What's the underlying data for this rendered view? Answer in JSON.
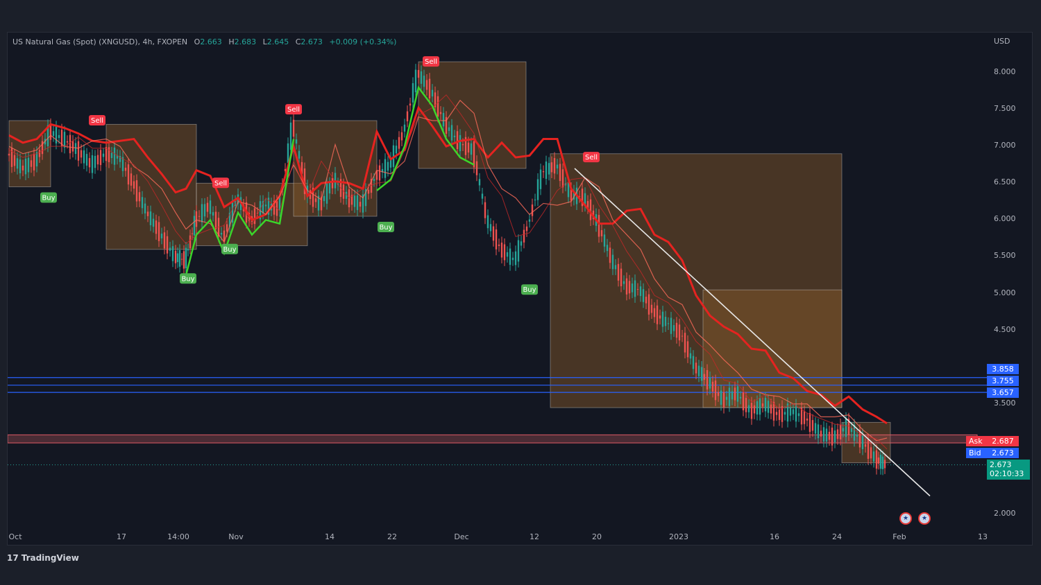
{
  "legend": {
    "symbol": "US Natural Gas (Spot) (XNGUSD), 4h, FXOPEN",
    "o_label": "O",
    "o_value": "2.663",
    "h_label": "H",
    "h_value": "2.683",
    "l_label": "L",
    "l_value": "2.645",
    "c_label": "C",
    "c_value": "2.673",
    "change": "+0.009 (+0.34%)"
  },
  "currency": "USD",
  "price_axis_labels": [
    "8.000",
    "7.500",
    "7.000",
    "6.500",
    "6.000",
    "5.500",
    "5.000",
    "4.500",
    "3.500",
    "2.000"
  ],
  "time_axis_labels": [
    "Oct",
    "17",
    "14:00",
    "Nov",
    "14",
    "22",
    "Dec",
    "12",
    "20",
    "2023",
    "16",
    "24",
    "Feb",
    "13"
  ],
  "tags": {
    "level1": "3.858",
    "level2": "3.755",
    "level3": "3.657",
    "ask_label": "Ask",
    "ask_value": "2.687",
    "bid_label": "Bid",
    "bid_value": "2.673",
    "last_value": "2.673",
    "countdown": "02:10:33"
  },
  "signals": {
    "sell": "Sell",
    "buy": "Buy"
  },
  "footer": {
    "brand": "TradingView"
  },
  "colors": {
    "background": "#131722",
    "bull": "#26a69a",
    "bear": "#ef5350",
    "ma_red": "#e52320",
    "ma_green": "#3bd62a",
    "level_blue": "#2962ff",
    "zone_orange": "#8a5a2a"
  },
  "chart_data": {
    "type": "line",
    "title": "US Natural Gas (Spot) (XNGUSD), 4h, FXOPEN",
    "ylabel": "USD",
    "ylim": [
      1.75,
      8.4
    ],
    "x": [
      "Oct",
      "17",
      "14:00",
      "Nov",
      "14",
      "22",
      "Dec",
      "12",
      "20",
      "2023",
      "16",
      "24",
      "Feb",
      "13"
    ],
    "series": [
      {
        "values": [
          [
            0,
            6.9
          ],
          [
            20,
            6.7
          ],
          [
            40,
            6.8
          ],
          [
            60,
            7.2
          ],
          [
            80,
            7.1
          ],
          [
            100,
            6.95
          ],
          [
            120,
            6.75
          ],
          [
            140,
            6.9
          ],
          [
            160,
            6.85
          ],
          [
            180,
            6.5
          ],
          [
            200,
            6.1
          ],
          [
            220,
            5.8
          ],
          [
            240,
            5.5
          ],
          [
            255,
            5.45
          ],
          [
            270,
            6.0
          ],
          [
            290,
            6.2
          ],
          [
            310,
            5.75
          ],
          [
            330,
            6.3
          ],
          [
            350,
            6.0
          ],
          [
            370,
            6.2
          ],
          [
            390,
            6.15
          ],
          [
            410,
            7.3
          ],
          [
            430,
            6.4
          ],
          [
            450,
            6.2
          ],
          [
            470,
            6.55
          ],
          [
            490,
            6.3
          ],
          [
            510,
            6.2
          ],
          [
            530,
            6.6
          ],
          [
            550,
            6.75
          ],
          [
            570,
            7.2
          ],
          [
            590,
            8.0
          ],
          [
            610,
            7.75
          ],
          [
            630,
            7.3
          ],
          [
            650,
            7.05
          ],
          [
            670,
            6.95
          ],
          [
            690,
            6.0
          ],
          [
            710,
            5.6
          ],
          [
            730,
            5.45
          ],
          [
            750,
            5.95
          ],
          [
            770,
            6.65
          ],
          [
            790,
            6.75
          ],
          [
            810,
            6.35
          ],
          [
            830,
            6.3
          ],
          [
            850,
            5.95
          ],
          [
            870,
            5.45
          ],
          [
            890,
            5.1
          ],
          [
            910,
            5.05
          ],
          [
            930,
            4.75
          ],
          [
            950,
            4.6
          ],
          [
            970,
            4.45
          ],
          [
            990,
            4.0
          ],
          [
            1010,
            3.8
          ],
          [
            1030,
            3.55
          ],
          [
            1050,
            3.65
          ],
          [
            1070,
            3.4
          ],
          [
            1090,
            3.5
          ],
          [
            1110,
            3.35
          ],
          [
            1130,
            3.4
          ],
          [
            1150,
            3.3
          ],
          [
            1170,
            3.1
          ],
          [
            1190,
            3.05
          ],
          [
            1210,
            3.2
          ],
          [
            1230,
            3.0
          ],
          [
            1250,
            2.75
          ],
          [
            1265,
            2.673
          ]
        ]
      }
    ],
    "horizontal_levels": [
      3.858,
      3.755,
      3.657
    ],
    "resistance_zone": [
      2.97,
      3.08
    ],
    "last_price": 2.673
  }
}
